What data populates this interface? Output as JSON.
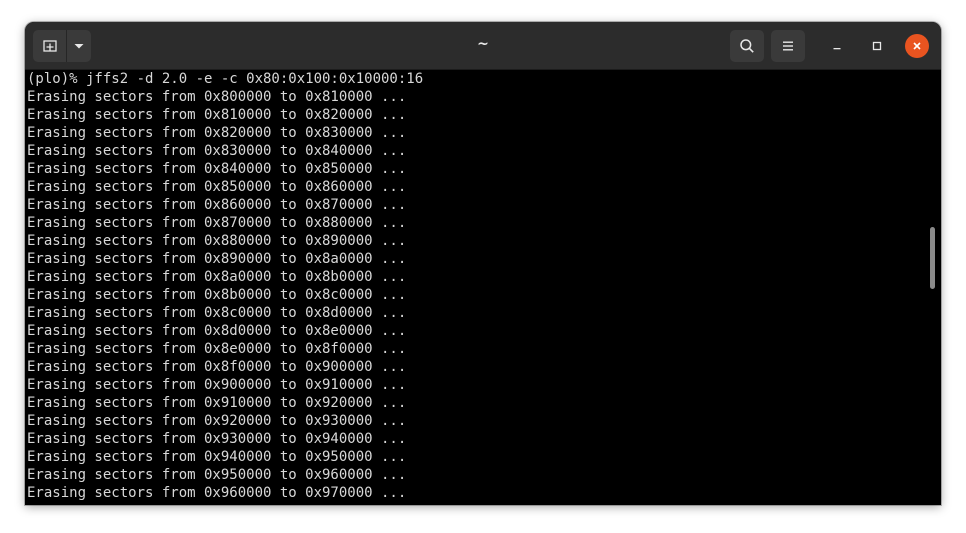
{
  "window": {
    "title": "~"
  },
  "titlebar": {
    "new_tab_icon": "new-tab-icon",
    "dropdown_icon": "chevron-down-icon",
    "search_icon": "search-icon",
    "menu_icon": "hamburger-menu-icon",
    "minimize_icon": "minimize-icon",
    "maximize_icon": "maximize-icon",
    "close_icon": "close-icon",
    "close_color": "#e95420"
  },
  "terminal": {
    "background": "#000000",
    "foreground": "#d8d8d8",
    "lines": [
      "(plo)% jffs2 -d 2.0 -e -c 0x80:0x100:0x10000:16",
      "Erasing sectors from 0x800000 to 0x810000 ...",
      "Erasing sectors from 0x810000 to 0x820000 ...",
      "Erasing sectors from 0x820000 to 0x830000 ...",
      "Erasing sectors from 0x830000 to 0x840000 ...",
      "Erasing sectors from 0x840000 to 0x850000 ...",
      "Erasing sectors from 0x850000 to 0x860000 ...",
      "Erasing sectors from 0x860000 to 0x870000 ...",
      "Erasing sectors from 0x870000 to 0x880000 ...",
      "Erasing sectors from 0x880000 to 0x890000 ...",
      "Erasing sectors from 0x890000 to 0x8a0000 ...",
      "Erasing sectors from 0x8a0000 to 0x8b0000 ...",
      "Erasing sectors from 0x8b0000 to 0x8c0000 ...",
      "Erasing sectors from 0x8c0000 to 0x8d0000 ...",
      "Erasing sectors from 0x8d0000 to 0x8e0000 ...",
      "Erasing sectors from 0x8e0000 to 0x8f0000 ...",
      "Erasing sectors from 0x8f0000 to 0x900000 ...",
      "Erasing sectors from 0x900000 to 0x910000 ...",
      "Erasing sectors from 0x910000 to 0x920000 ...",
      "Erasing sectors from 0x920000 to 0x930000 ...",
      "Erasing sectors from 0x930000 to 0x940000 ...",
      "Erasing sectors from 0x940000 to 0x950000 ...",
      "Erasing sectors from 0x950000 to 0x960000 ...",
      "Erasing sectors from 0x960000 to 0x970000 ..."
    ]
  }
}
